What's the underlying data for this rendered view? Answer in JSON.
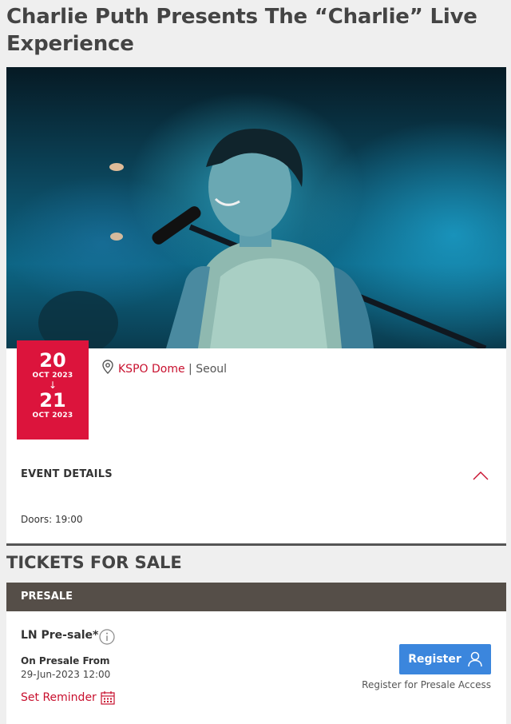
{
  "event": {
    "title": "Charlie Puth Presents The “Charlie” Live Experience"
  },
  "date": {
    "start_day": "20",
    "start_month_year": "OCT 2023",
    "arrow": "↓",
    "end_day": "21",
    "end_month_year": "OCT 2023"
  },
  "venue": {
    "name": "KSPO Dome",
    "separator": " | ",
    "city": "Seoul",
    "icon": "map-pin-icon"
  },
  "details": {
    "heading": "EVENT DETAILS",
    "doors": "Doors: 19:00",
    "toggle_icon": "chevron-up-icon"
  },
  "tickets": {
    "heading": "TICKETS FOR SALE",
    "section_label": "PRESALE",
    "presale_name": "LN Pre-sale*",
    "on_presale_label": "On Presale From",
    "on_presale_date": "29-Jun-2023 12:00",
    "set_reminder": "Set Reminder",
    "register_label": "Register",
    "register_note": "Register for Presale Access"
  },
  "colors": {
    "accent_red": "#dc143c",
    "register_blue": "#3b86dd",
    "presale_bar": "#554e48"
  }
}
